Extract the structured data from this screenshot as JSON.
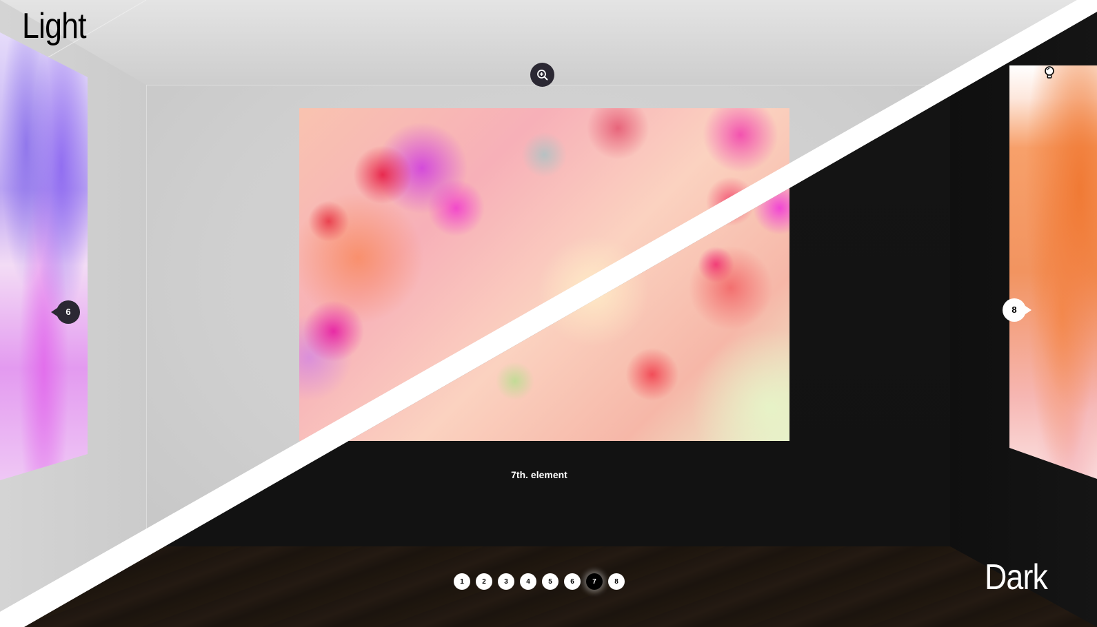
{
  "themes": {
    "light_label": "Light",
    "dark_label": "Dark"
  },
  "gallery": {
    "current_index": 7,
    "caption": "7th. element",
    "prev_label": "6",
    "next_label": "8",
    "zoom_icon": "zoom-in-icon",
    "light_toggle_icon": "lightbulb-icon"
  },
  "pager": {
    "items": [
      "1",
      "2",
      "3",
      "4",
      "5",
      "6",
      "7",
      "8"
    ],
    "active": "7"
  },
  "colors": {
    "light_wall": "#cfcfcf",
    "dark_wall": "#131313",
    "floor": "#21180f",
    "control_dark": "#2b2833",
    "separator": "#ffffff"
  }
}
